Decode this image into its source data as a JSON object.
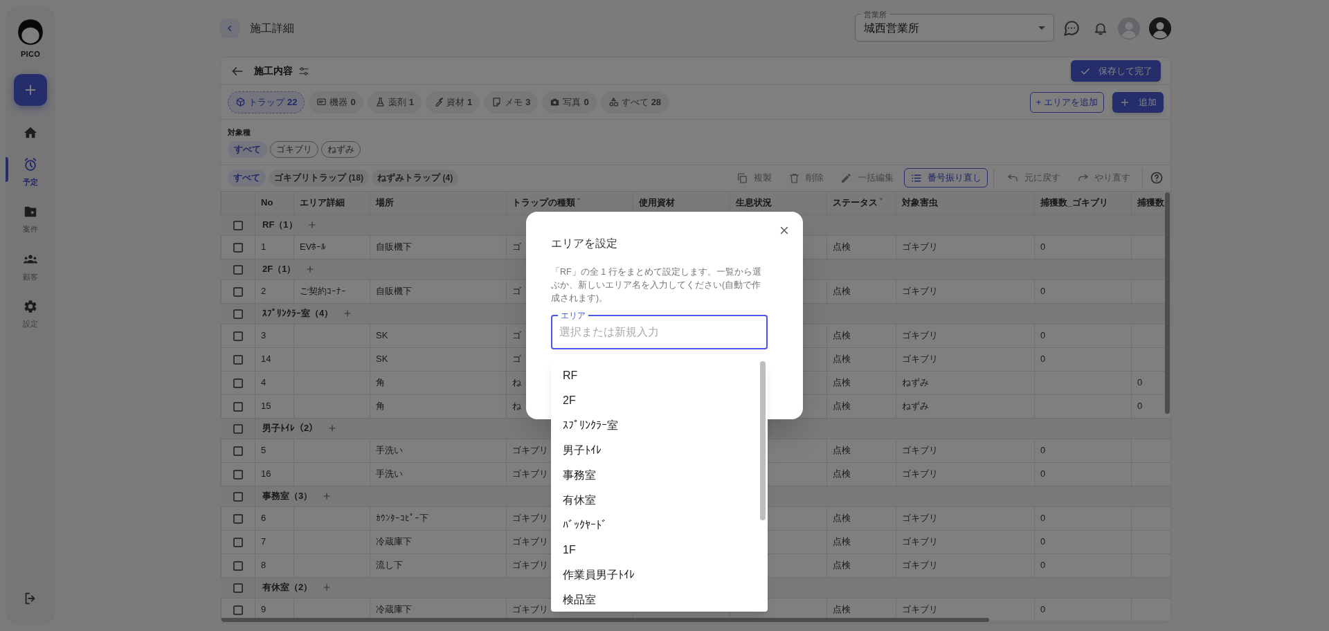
{
  "sidebar": {
    "logo_text": "PICO",
    "nav": [
      {
        "selected": false
      },
      {
        "label": "予定",
        "selected": true
      },
      {
        "label": "案件",
        "selected": false
      },
      {
        "label": "顧客",
        "selected": false
      },
      {
        "label": "設定",
        "selected": false
      }
    ]
  },
  "header": {
    "title": "施工詳細",
    "office_select": {
      "label": "営業所",
      "value": "城西営業所"
    }
  },
  "panel": {
    "title": "施工内容",
    "save_button": "保存して完了",
    "add_area_button": "+ エリアを追加",
    "add_button": "追加",
    "tabs": [
      {
        "label": "トラップ",
        "count": "22",
        "selected": true
      },
      {
        "label": "機器",
        "count": "0",
        "selected": false
      },
      {
        "label": "薬剤",
        "count": "1",
        "selected": false
      },
      {
        "label": "資材",
        "count": "1",
        "selected": false
      },
      {
        "label": "メモ",
        "count": "3",
        "selected": false
      },
      {
        "label": "写真",
        "count": "0",
        "selected": false
      },
      {
        "label": "すべて",
        "count": "28",
        "selected": false
      }
    ],
    "species_filter": {
      "label": "対象種",
      "options": [
        {
          "label": "すべて",
          "selected": true
        },
        {
          "label": "ゴキブリ",
          "selected": false
        },
        {
          "label": "ねずみ",
          "selected": false
        }
      ]
    },
    "trap_filter": [
      {
        "label": "すべて",
        "selected": true
      },
      {
        "label": "ゴキブリトラップ",
        "count": "(18)",
        "selected": false
      },
      {
        "label": "ねずみトラップ",
        "count": "(4)",
        "selected": false
      }
    ],
    "toolbar": [
      {
        "label": "複製",
        "disabled": true
      },
      {
        "label": "削除",
        "disabled": true
      },
      {
        "label": "一括編集",
        "disabled": true
      },
      {
        "label": "番号振り直し",
        "disabled": false
      },
      {
        "label": "元に戻す",
        "disabled": true
      },
      {
        "label": "やり直す",
        "disabled": true
      }
    ]
  },
  "table": {
    "columns": [
      {
        "label": "No"
      },
      {
        "label": "エリア詳細"
      },
      {
        "label": "場所"
      },
      {
        "label": "トラップの種類",
        "required_mark": "*"
      },
      {
        "label": "使用資材"
      },
      {
        "label": "生息状況"
      },
      {
        "label": "ステータス",
        "required_mark": "*"
      },
      {
        "label": "対象害虫"
      },
      {
        "label": "捕獲数_ゴキブリ"
      },
      {
        "label": "捕獲数"
      }
    ],
    "rows": [
      {
        "kind": "group",
        "label": "RF（1）",
        "checked": false
      },
      {
        "kind": "row",
        "checked": false,
        "no": "1",
        "area_detail": "EVﾎｰﾙ",
        "place": "自販機下",
        "trap_type": "ゴ",
        "status": "点検",
        "target_pest": "ゴキブリ",
        "catch_cockroach": "0"
      },
      {
        "kind": "group",
        "label": "2F（1）",
        "checked": false
      },
      {
        "kind": "row",
        "checked": false,
        "no": "2",
        "area_detail": "ご契約ｺｰﾅｰ",
        "place": "自販機下",
        "trap_type": "ゴ",
        "status": "点検",
        "target_pest": "ゴキブリ",
        "catch_cockroach": "0"
      },
      {
        "kind": "group",
        "label": "ｽﾌﾟﾘﾝｸﾗｰ室（4）",
        "checked": false
      },
      {
        "kind": "row",
        "checked": false,
        "no": "3",
        "place": "SK",
        "trap_type": "ゴ",
        "status": "点検",
        "target_pest": "ゴキブリ",
        "catch_cockroach": "0"
      },
      {
        "kind": "row",
        "checked": false,
        "no": "14",
        "place": "SK",
        "trap_type": "ゴ",
        "status": "点検",
        "target_pest": "ゴキブリ",
        "catch_cockroach": "0"
      },
      {
        "kind": "row",
        "checked": false,
        "no": "4",
        "place": "角",
        "trap_type": "ね",
        "status": "点検",
        "target_pest": "ねずみ",
        "catch_other": "0"
      },
      {
        "kind": "row",
        "checked": false,
        "no": "15",
        "place": "角",
        "trap_type": "ね",
        "status": "点検",
        "target_pest": "ねずみ",
        "catch_other": "0"
      },
      {
        "kind": "group",
        "label": "男子ﾄｲﾚ（2）",
        "checked": false
      },
      {
        "kind": "row",
        "checked": false,
        "no": "5",
        "place": "手洗い",
        "trap_type": "ゴキブリ",
        "status": "点検",
        "target_pest": "ゴキブリ",
        "catch_cockroach": "0"
      },
      {
        "kind": "row",
        "checked": false,
        "no": "16",
        "place": "手洗い",
        "trap_type": "ゴキブリ",
        "status": "点検",
        "target_pest": "ゴキブリ",
        "catch_cockroach": "0"
      },
      {
        "kind": "group",
        "label": "事務室（3）",
        "checked": false
      },
      {
        "kind": "row",
        "checked": false,
        "no": "6",
        "place": "ｶｳﾝﾀｰｺﾋﾟｰ下",
        "trap_type": "ゴキブリ",
        "status": "点検",
        "target_pest": "ゴキブリ",
        "catch_cockroach": "0"
      },
      {
        "kind": "row",
        "checked": false,
        "no": "7",
        "place": "冷蔵庫下",
        "trap_type": "ゴキブリ",
        "status": "点検",
        "target_pest": "ゴキブリ",
        "catch_cockroach": "0"
      },
      {
        "kind": "row",
        "checked": false,
        "no": "8",
        "place": "流し下",
        "trap_type": "ゴキブリ",
        "status": "点検",
        "target_pest": "ゴキブリ",
        "catch_cockroach": "0"
      },
      {
        "kind": "group",
        "label": "有休室（2）",
        "checked": false
      },
      {
        "kind": "row",
        "checked": false,
        "no": "9",
        "place": "冷蔵庫下",
        "trap_type": "ゴキブリ",
        "status": "点検",
        "target_pest": "ゴキブリ",
        "catch_cockroach": "0"
      }
    ]
  },
  "dialog": {
    "title": "エリアを設定",
    "description": "「RF」の全 1 行をまとめて設定します。一覧から選ぶか、新しいエリア名を入力してください(自動で作成されます)。",
    "field": {
      "label": "エリア",
      "placeholder": "選択または新規入力"
    },
    "options": [
      "RF",
      "2F",
      "ｽﾌﾟﾘﾝｸﾗｰ室",
      "男子ﾄｲﾚ",
      "事務室",
      "有休室",
      "ﾊﾞｯｸﾔｰﾄﾞ",
      "1F",
      "作業員男子ﾄｲﾚ",
      "検品室"
    ]
  }
}
